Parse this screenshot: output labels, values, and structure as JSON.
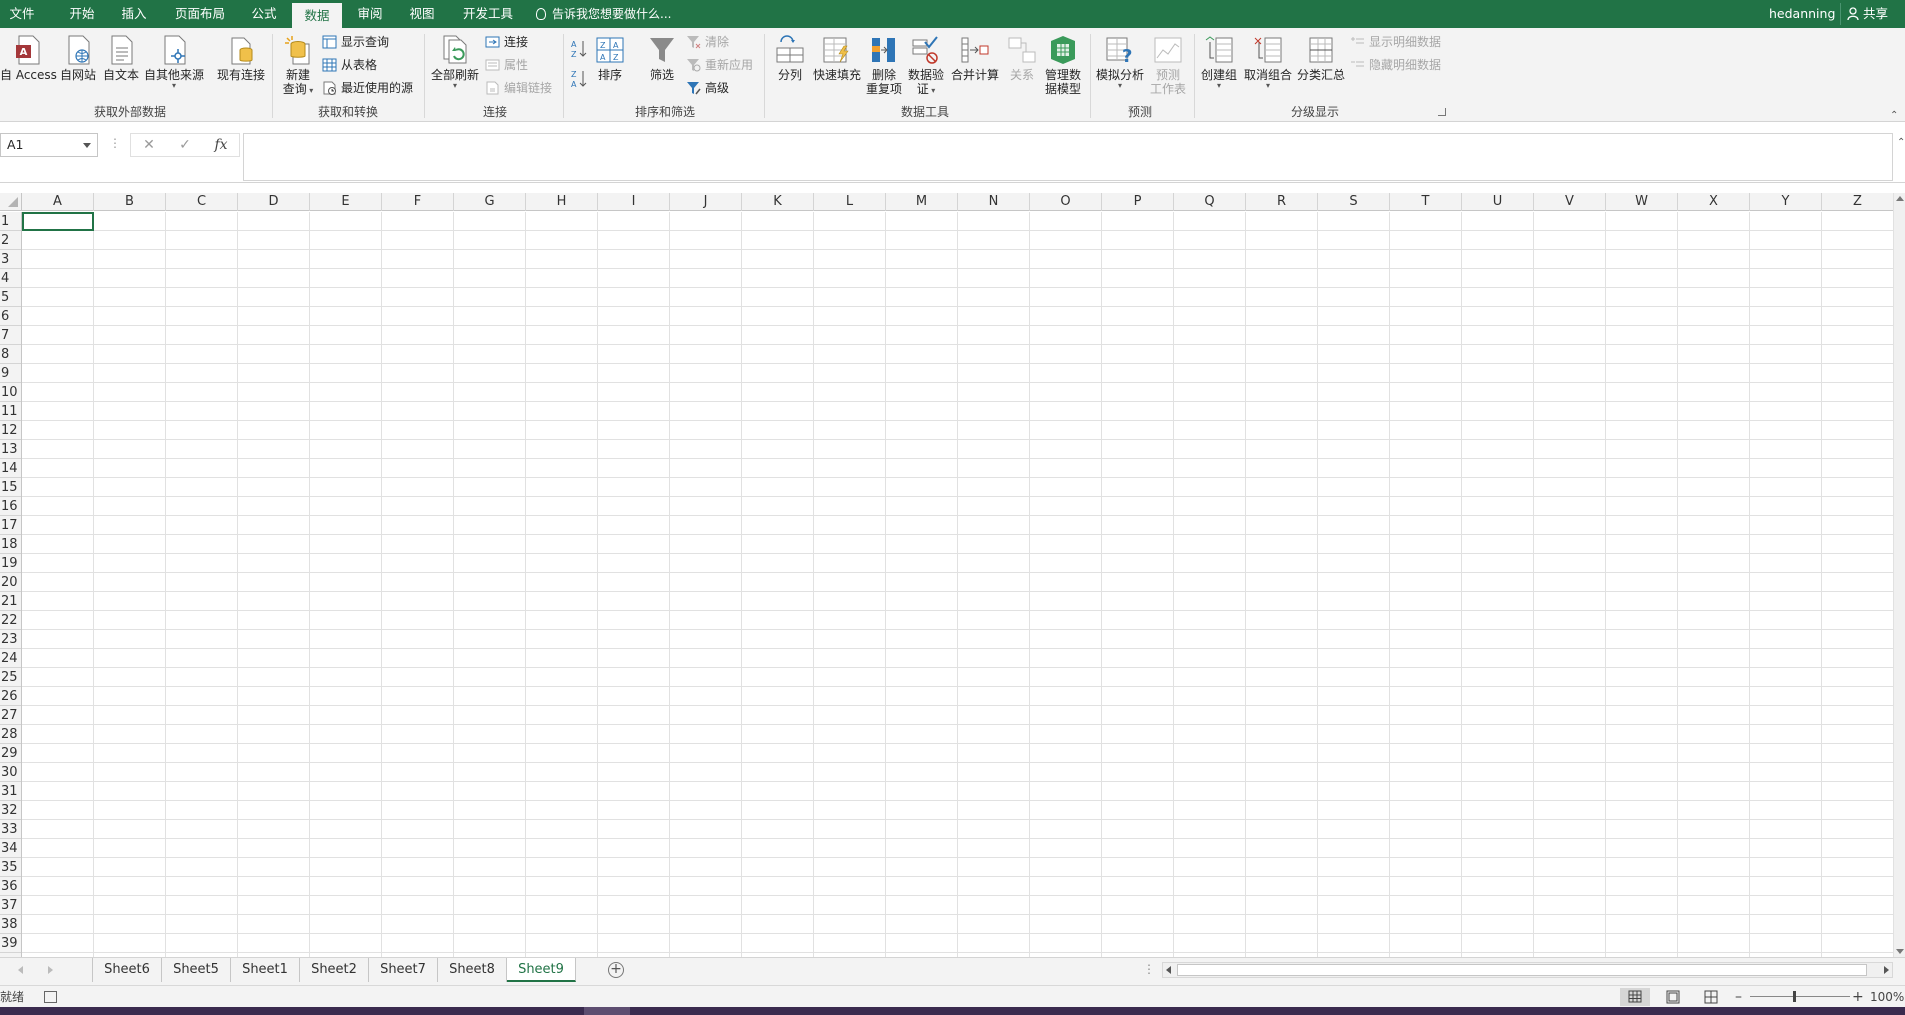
{
  "tabs": [
    {
      "label": "文件",
      "active": false
    },
    {
      "label": "开始",
      "active": false
    },
    {
      "label": "插入",
      "active": false
    },
    {
      "label": "页面布局",
      "active": false
    },
    {
      "label": "公式",
      "active": false
    },
    {
      "label": "数据",
      "active": true
    },
    {
      "label": "审阅",
      "active": false
    },
    {
      "label": "视图",
      "active": false
    },
    {
      "label": "开发工具",
      "active": false
    }
  ],
  "tellme": "告诉我您想要做什么...",
  "user": "hedanning",
  "share": "共享",
  "ribbon": {
    "get_external": {
      "label": "获取外部数据",
      "access": "自 Access",
      "web": "自网站",
      "text": "自文本",
      "other": "自其他来源",
      "existing": "现有连接"
    },
    "transform": {
      "label": "获取和转换",
      "new_query_1": "新建",
      "new_query_2": "查询",
      "show_queries": "显示查询",
      "from_table": "从表格",
      "recent_sources": "最近使用的源"
    },
    "connections": {
      "label": "连接",
      "refresh_all": "全部刷新",
      "connections": "连接",
      "properties": "属性",
      "edit_links": "编辑链接"
    },
    "sort_filter": {
      "label": "排序和筛选",
      "sort": "排序",
      "filter": "筛选",
      "clear": "清除",
      "reapply": "重新应用",
      "advanced": "高级"
    },
    "data_tools": {
      "label": "数据工具",
      "text_to_columns": "分列",
      "flash_fill": "快速填充",
      "remove_dup_1": "删除",
      "remove_dup_2": "重复项",
      "validation_1": "数据验",
      "validation_2": "证",
      "consolidate": "合并计算",
      "relationships": "关系",
      "data_model_1": "管理数",
      "data_model_2": "据模型"
    },
    "forecast": {
      "label": "预测",
      "what_if": "模拟分析",
      "sheet_1": "预测",
      "sheet_2": "工作表"
    },
    "outline": {
      "label": "分级显示",
      "group": "创建组",
      "ungroup": "取消组合",
      "subtotal": "分类汇总",
      "show_detail": "显示明细数据",
      "hide_detail": "隐藏明细数据"
    }
  },
  "namebox": "A1",
  "columns": [
    "A",
    "B",
    "C",
    "D",
    "E",
    "F",
    "G",
    "H",
    "I",
    "J",
    "K",
    "L",
    "M",
    "N",
    "O",
    "P",
    "Q",
    "R",
    "S",
    "T",
    "U",
    "V",
    "W",
    "X",
    "Y",
    "Z"
  ],
  "row_count": 39,
  "sheets": [
    {
      "label": "Sheet6",
      "active": false
    },
    {
      "label": "Sheet5",
      "active": false
    },
    {
      "label": "Sheet1",
      "active": false
    },
    {
      "label": "Sheet2",
      "active": false
    },
    {
      "label": "Sheet7",
      "active": false
    },
    {
      "label": "Sheet8",
      "active": false
    },
    {
      "label": "Sheet9",
      "active": true
    }
  ],
  "status": "就绪",
  "zoom": "100%",
  "colors": {
    "accent": "#217346",
    "ribbon_bg": "#f3f3f3",
    "grid_line": "#e1e1e1"
  }
}
